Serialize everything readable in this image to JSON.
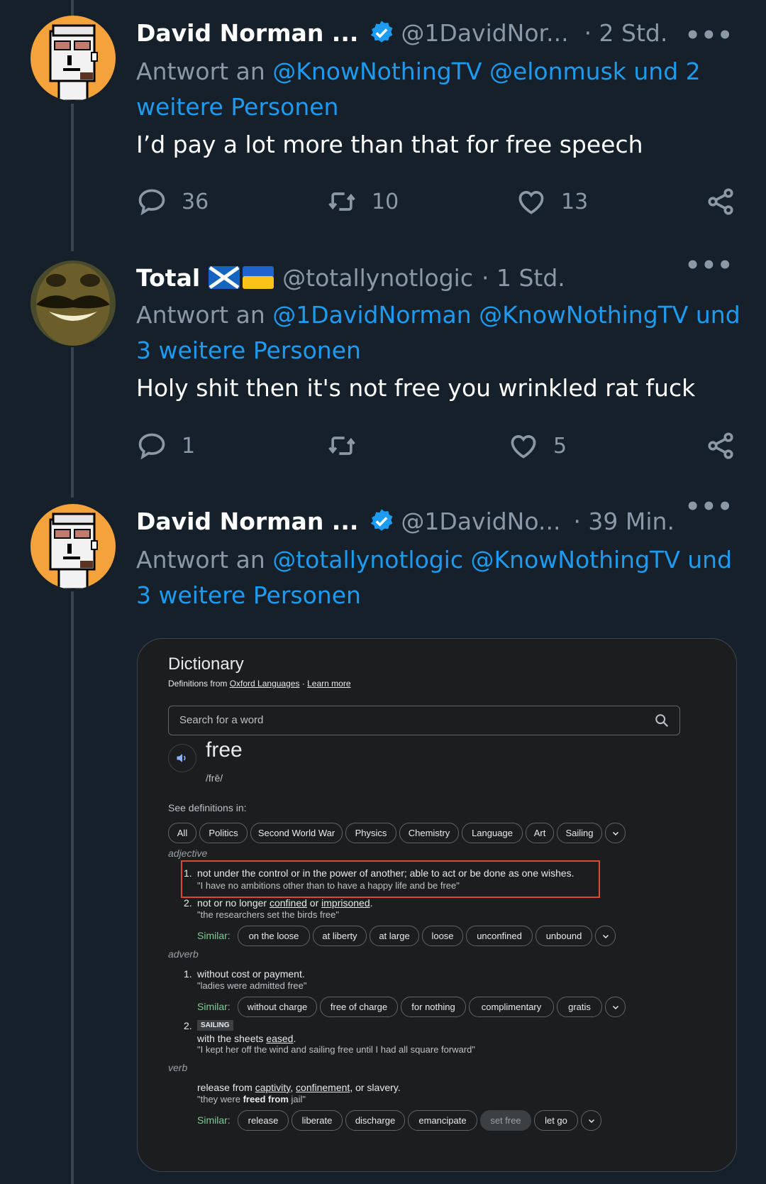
{
  "tweets": [
    {
      "name": "David Norman ...",
      "handle": "@1DavidNor...",
      "time": "· 2 Std.",
      "more": "•••",
      "reply_prefix": "Antwort an ",
      "reply_links": "@KnowNothingTV @elonmusk und 2 weitere Personen",
      "text": "I’d pay a lot more than that for free speech",
      "replies": "36",
      "retweets": "10",
      "likes": "13"
    },
    {
      "name": "Total",
      "handle": "@totallynotlogic",
      "time": "· 1 Std.",
      "more": "•••",
      "reply_prefix": "Antwort an ",
      "reply_links": "@1DavidNorman @KnowNothingTV und 3 weitere Personen",
      "text": "Holy shit then it's not free you wrinkled rat fuck",
      "replies": "1",
      "retweets": "",
      "likes": "5"
    },
    {
      "name": "David Norman ...",
      "handle": "@1DavidNo...",
      "time": "· 39 Min.",
      "more": "•••",
      "reply_prefix": "Antwort an ",
      "reply_links": "@totallynotlogic @KnowNothingTV und 3 weitere Personen"
    }
  ],
  "dictionary": {
    "title": "Dictionary",
    "source_prefix": "Definitions from ",
    "source_link": "Oxford Languages",
    "source_sep": " · ",
    "learn_more": "Learn more",
    "search_placeholder": "Search for a word",
    "word": "free",
    "pronunciation": "/frē/",
    "see_definitions": "See definitions in:",
    "categories": [
      "All",
      "Politics",
      "Second World War",
      "Physics",
      "Chemistry",
      "Language",
      "Art",
      "Sailing"
    ],
    "adjective_label": "adjective",
    "adj1_num": "1.",
    "adj1_def": "not under the control or in the power of another; able to act or be done as one wishes.",
    "adj1_ex": "\"I have no ambitions other than to have a happy life and be free\"",
    "adj2_num": "2.",
    "adj2_def_a": "not or no longer ",
    "adj2_def_b": "confined",
    "adj2_def_c": " or ",
    "adj2_def_d": "imprisoned",
    "adj2_def_e": ".",
    "adj2_ex": "\"the researchers set the birds free\"",
    "similar_label": "Similar:",
    "adj_similar": [
      "on the loose",
      "at liberty",
      "at large",
      "loose",
      "unconfined",
      "unbound"
    ],
    "adverb_label": "adverb",
    "adv1_num": "1.",
    "adv1_def": "without cost or payment.",
    "adv1_ex": "\"ladies were admitted free\"",
    "adv_similar": [
      "without charge",
      "free of charge",
      "for nothing",
      "complimentary",
      "gratis"
    ],
    "adv2_num": "2.",
    "adv2_tag": "SAILING",
    "adv2_def_a": "with the sheets ",
    "adv2_def_b": "eased",
    "adv2_def_c": ".",
    "adv2_ex": "\"I kept her off the wind and sailing free until I had all square forward\"",
    "verb_label": "verb",
    "verb_def_a": "release from ",
    "verb_def_b": "captivity",
    "verb_def_c": ", ",
    "verb_def_d": "confinement",
    "verb_def_e": ", or slavery.",
    "verb_ex_a": "\"they were ",
    "verb_ex_b": "freed from",
    "verb_ex_c": " jail\"",
    "verb_similar": [
      "release",
      "liberate",
      "discharge",
      "emancipate",
      "set free",
      "let go"
    ]
  },
  "colors": {
    "background": "#15202b",
    "link": "#1d9bf0",
    "muted": "#8b98a5",
    "similar_label": "#81c995",
    "highlight_box": "#e0482f"
  },
  "icons": [
    "verified-badge-icon",
    "more-icon",
    "reply-icon",
    "retweet-icon",
    "like-icon",
    "share-icon",
    "search-icon",
    "speaker-icon",
    "chevron-down-icon",
    "scotland-flag-icon",
    "ukraine-flag-icon"
  ]
}
